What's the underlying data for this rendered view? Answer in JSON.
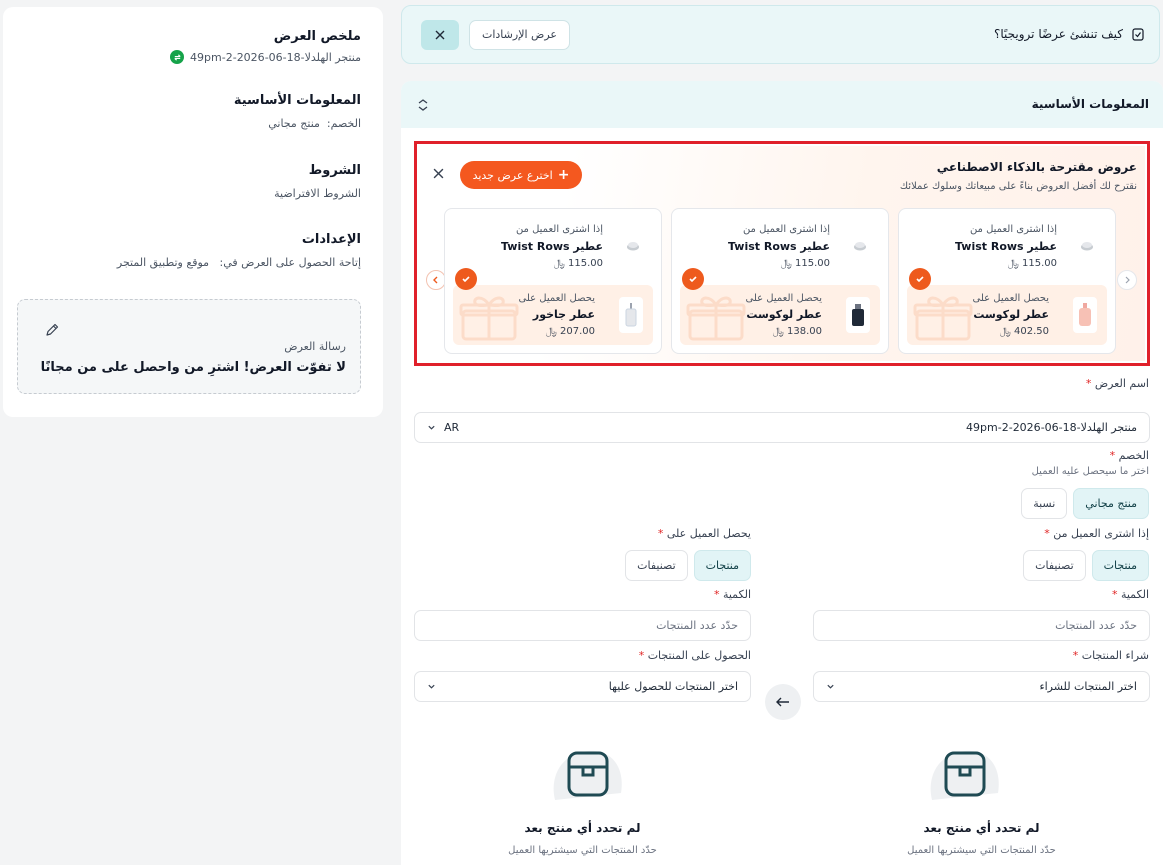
{
  "summary": {
    "title": "ملخص العرض",
    "offer_id": "منتجر الهلدلا-18-06-2026-2-49pm",
    "basic_title": "المعلومات الأساسية",
    "discount_label": "الخصم:",
    "discount_value": "منتج مجاني",
    "terms_title": "الشروط",
    "terms_value": "الشروط الافتراضية",
    "settings_title": "الإعدادات",
    "availability_label": "إتاحة الحصول على العرض في:",
    "availability_value": "موقع وتطبيق المتجر",
    "message_label": "رسالة العرض",
    "message_text": "لا تفوّت العرض! اشترِ من واحصل على من مجانًا"
  },
  "guide": {
    "text": "كيف تنشئ عرضًا ترويجيًا؟",
    "button": "عرض الإرشادات"
  },
  "main": {
    "section_title": "المعلومات الأساسية"
  },
  "ai": {
    "title": "عروض مقترحة بالذكاء الاصطناعي",
    "subtitle": "نقترح لك أفضل العروض بناءً على مبيعاتك وسلوك عملائك",
    "new_button": "اخترع عرض جديد",
    "cards": [
      {
        "buy_label": "إذا اشترى العميل من",
        "buy_name": "عطير Twist Rows",
        "buy_price": "115.00",
        "get_label": "يحصل العميل على",
        "get_name": "عطر لوكوست",
        "get_price": "402.50"
      },
      {
        "buy_label": "إذا اشترى العميل من",
        "buy_name": "عطير Twist Rows",
        "buy_price": "115.00",
        "get_label": "يحصل العميل على",
        "get_name": "عطر لوكوست",
        "get_price": "138.00"
      },
      {
        "buy_label": "إذا اشترى العميل من",
        "buy_name": "عطير Twist Rows",
        "buy_price": "115.00",
        "get_label": "يحصل العميل على",
        "get_name": "عطر جاخور",
        "get_price": "207.00"
      }
    ],
    "currency_symbol": "﷼"
  },
  "form": {
    "offer_name_label": "اسم العرض",
    "offer_name_value": "منتجر الهلدلا-18-06-2026-2-49pm",
    "lang": "AR",
    "discount_label": "الخصم",
    "discount_hint": "اختر ما سيحصل عليه العميل",
    "discount_options": [
      "منتج مجاني",
      "نسبة"
    ],
    "buy_from_label": "إذا اشترى العميل من",
    "get_on_label": "يحصل العميل على",
    "type_options": [
      "منتجات",
      "تصنيفات"
    ],
    "quantity_label": "الكمية",
    "quantity_placeholder": "حدّد عدد المنتجات",
    "buy_products_label": "شراء المنتجات",
    "buy_products_placeholder": "اختر المنتجات للشراء",
    "get_products_label": "الحصول على المنتجات",
    "get_products_placeholder": "اختر المنتجات للحصول عليها",
    "empty_title": "لم تحدد أي منتج بعد",
    "empty_buy_sub": "حدّد المنتجات التي سيشتريها العميل",
    "empty_get_sub": "حدّد المنتجات التي سيشتريها العميل"
  },
  "colors": {
    "accent": "#f4581f",
    "teal_light": "#eaf7f8",
    "highlight_border": "#e0202a"
  }
}
